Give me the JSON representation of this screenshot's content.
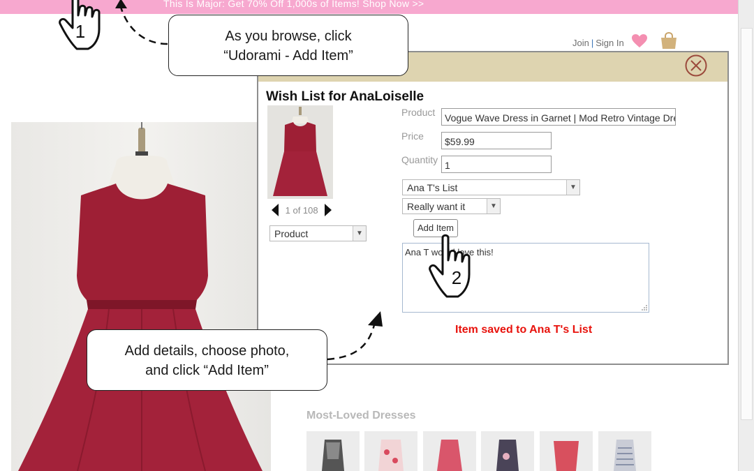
{
  "promo": {
    "text": "This Is Major: Get 70% Off 1,000s of Items! Shop Now >>"
  },
  "header": {
    "join": "Join",
    "separator": "|",
    "signin": "Sign In"
  },
  "callouts": {
    "browse_line1": "As you browse, click",
    "browse_line2": "“Udorami - Add Item”",
    "details_line1": "Add details, choose photo,",
    "details_line2": "and click “Add Item”"
  },
  "steps": {
    "one": "1",
    "two": "2"
  },
  "wishlist": {
    "title": "Wish List for AnaLoiselle",
    "pager": "1 of 108",
    "image_type": "Product",
    "labels": {
      "product": "Product",
      "price": "Price",
      "quantity": "Quantity"
    },
    "product_value": "Vogue Wave Dress in Garnet | Mod Retro Vintage Dress",
    "price_value": "$59.99",
    "quantity_value": "1",
    "list_select": "Ana T's List",
    "priority_select": "Really want it",
    "add_button": "Add Item",
    "note": "Ana T would love this!",
    "saved_message": "Item saved to Ana T's List"
  },
  "most_loved": {
    "title": "Most-Loved Dresses"
  },
  "colors": {
    "promo": "#f7a8cf",
    "panel_header": "#ded4b0",
    "dress": "#9e1f35",
    "saved": "#e8120c"
  },
  "icons": [
    "pointing-hand-icon",
    "heart-icon",
    "shopping-bag-icon",
    "close-circle-icon",
    "prev-arrow-icon",
    "next-arrow-icon",
    "resize-grip-icon"
  ]
}
